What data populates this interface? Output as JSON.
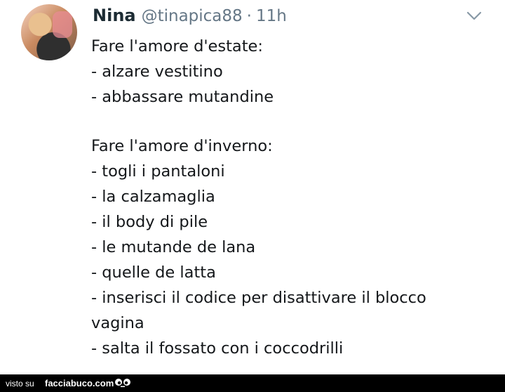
{
  "tweet": {
    "name": "Nina",
    "handle": "@tinapica88",
    "separator": "·",
    "time": "11h",
    "lines": [
      "Fare l'amore d'estate:",
      "- alzare vestitino",
      "- abbassare mutandine",
      "",
      "Fare l'amore d'inverno:",
      "- togli i pantaloni",
      "- la calzamaglia",
      "- il body di pile",
      "- le mutande de lana",
      "- quelle de latta",
      "- inserisci il codice per disattivare il blocco",
      "vagina",
      "- salta il fossato con i coccodrilli"
    ],
    "more_icon": "chevron-down-icon",
    "colors": {
      "name": "#1c2b33",
      "muted": "#657786",
      "text": "#14171a"
    }
  },
  "footer": {
    "visto_label": "visto su",
    "site_label": "facciabuco.com",
    "logo_icon": "eyes-icon",
    "background": "#000000"
  }
}
